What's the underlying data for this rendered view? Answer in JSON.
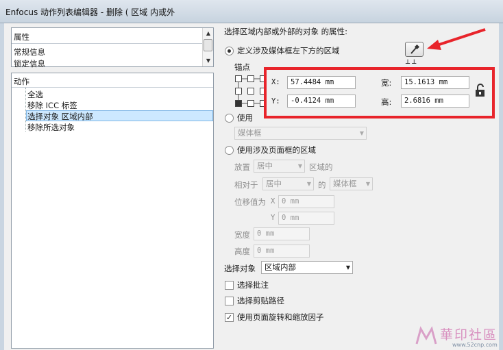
{
  "window": {
    "title": "Enfocus 动作列表编辑器 - 删除 ( 区域 内或外"
  },
  "properties_panel": {
    "header": "属性",
    "items": [
      "常规信息",
      "锁定信息"
    ]
  },
  "actions_panel": {
    "header": "动作",
    "items": [
      "全选",
      "移除 ICC 标签",
      "选择对象 区域内部",
      "移除所选对象"
    ]
  },
  "right_panel": {
    "section_title": "选择区域内部或外部的对象 的属性:",
    "option_define_label": "定义涉及媒体框左下方的区域",
    "anchor_label": "锚点",
    "x_label": "X:",
    "x_value": "57.4484 mm",
    "y_label": "Y:",
    "y_value": "-0.4124 mm",
    "width_label": "宽:",
    "width_value": "15.1613 mm",
    "height_label": "高:",
    "height_value": "2.6816 mm",
    "option_use_label": "使用",
    "use_box_select": "媒体框",
    "option_page_box_label": "使用涉及页面框的区域",
    "place_label": "放置",
    "place_value": "居中",
    "area_of_label": "区域的",
    "relative_label": "相对于",
    "relative_value": "居中",
    "of_label": "的",
    "relative_box_value": "媒体框",
    "offset_label": "位移值为",
    "offset_x_label": "X",
    "offset_x_value": "0 mm",
    "offset_y_label": "Y",
    "offset_y_value": "0 mm",
    "width2_label": "宽度",
    "width2_value": "0 mm",
    "height2_label": "高度",
    "height2_value": "0 mm",
    "select_object_label": "选择对象",
    "select_object_value": "区域内部",
    "cb_annotations_label": "选择批注",
    "cb_clip_label": "选择剪贴路径",
    "cb_rotate_label": "使用页面旋转和缩放因子"
  },
  "watermark": {
    "text": "華印社區",
    "url": "www.52cnp.com"
  },
  "colors": {
    "highlight": "#e8242b",
    "selection": "#cde8ff"
  }
}
